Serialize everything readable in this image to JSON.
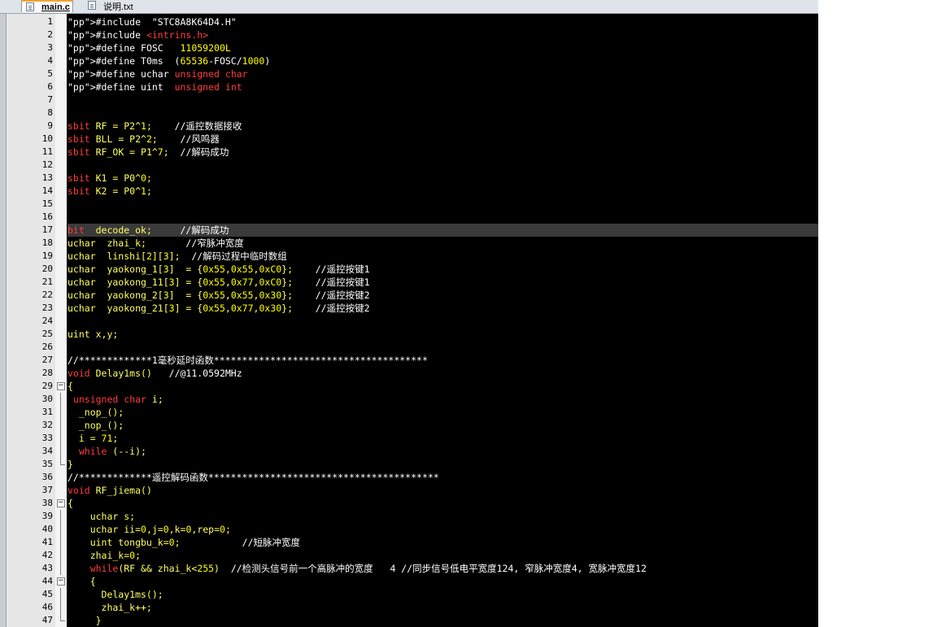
{
  "tabs": [
    {
      "label": "main.c",
      "active": true
    },
    {
      "label": "说明.txt",
      "active": false
    }
  ],
  "lines": [
    "#include  \"STC8A8K64D4.H\"",
    "#include <intrins.h>",
    "#define FOSC   11059200L",
    "#define T0ms  (65536-FOSC/1000)",
    "#define uchar unsigned char",
    "#define uint  unsigned int",
    "",
    "",
    "sbit RF = P2^1;    //遥控数据接收",
    "sbit BLL = P2^2;    //风鸣器",
    "sbit RF_OK = P1^7;  //解码成功",
    "",
    "sbit K1 = P0^0;",
    "sbit K2 = P0^1;",
    "",
    "",
    "bit  decode_ok;     //解码成功",
    "uchar  zhai_k;       //窄脉冲宽度",
    "uchar  linshi[2][3];  //解码过程中临时数组",
    "uchar  yaokong_1[3]  = {0x55,0x55,0xC0};    //遥控按键1",
    "uchar  yaokong_11[3] = {0x55,0x77,0xC0};    //遥控按键1",
    "uchar  yaokong_2[3]  = {0x55,0x55,0x30};    //遥控按键2",
    "uchar  yaokong_21[3] = {0x55,0x77,0x30};    //遥控按键2",
    "",
    "uint x,y;",
    "",
    "//*************1毫秒延时函数**************************************",
    "void Delay1ms()   //@11.0592MHz",
    "{",
    " unsigned char i;",
    "  _nop_();",
    "  _nop_();",
    "  i = 71;",
    "  while (--i);",
    "}",
    "//*************遥控解码函数*****************************************",
    "void RF_jiema()",
    "{",
    "    uchar s;",
    "    uchar ii=0,j=0,k=0,rep=0;",
    "    uint tongbu_k=0;           //短脉冲宽度",
    "    zhai_k=0;",
    "    while(RF && zhai_k<255)  //检测头信号前一个高脉冲的宽度   4 //同步信号低电平宽度124, 窄脉冲宽度4, 宽脉冲宽度12",
    "    {",
    "      Delay1ms();",
    "      zhai_k++;",
    "     }"
  ]
}
